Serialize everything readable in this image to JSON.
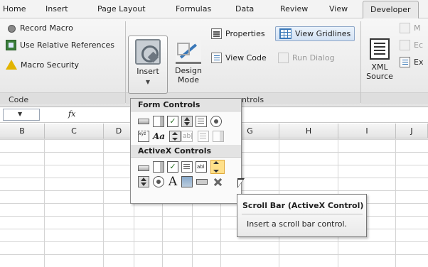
{
  "tabs": [
    "Home",
    "Insert",
    "Page Layout",
    "Formulas",
    "Data",
    "Review",
    "View",
    "Developer"
  ],
  "code_group": {
    "label": "Code",
    "record_macro": "Record Macro",
    "use_relative": "Use Relative References",
    "macro_security": "Macro Security"
  },
  "controls_group": {
    "insert_label": "Insert",
    "design_mode_line1": "Design",
    "design_mode_line2": "Mode",
    "properties": "Properties",
    "view_gridlines": "View Gridlines",
    "view_code": "View Code",
    "run_dialog": "Run Dialog",
    "label_partial": "ntrols"
  },
  "xml_group": {
    "xml_line1": "XML",
    "xml_line2": "Source",
    "m": "M",
    "e": "Ec",
    "ex": "Ex"
  },
  "formula_bar": {
    "name_box": "",
    "fx_label": "fx"
  },
  "columns": [
    "B",
    "C",
    "D",
    "G",
    "H",
    "I",
    "J"
  ],
  "insert_menu": {
    "form_header": "Form Controls",
    "activex_header": "ActiveX Controls"
  },
  "tooltip": {
    "title": "Scroll Bar (ActiveX Control)",
    "body": "Insert a scroll bar control."
  }
}
